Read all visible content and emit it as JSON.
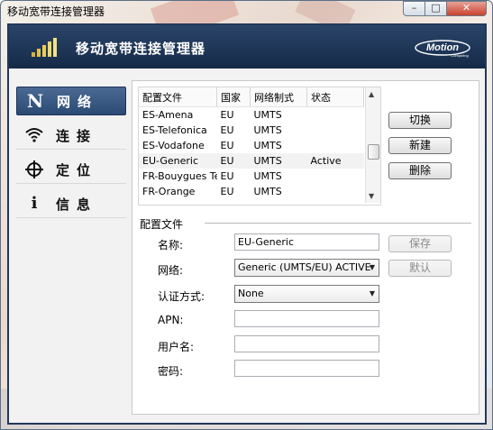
{
  "window": {
    "title": "移动宽带连接管理器",
    "minimize": "–",
    "maximize": "□",
    "close": "✕"
  },
  "header": {
    "title": "移动宽带连接管理器",
    "signal_icon": "signal-bars-icon",
    "logo_main": "Motion",
    "logo_sub": "Computing"
  },
  "nav": [
    {
      "id": "network",
      "icon_char": "N",
      "label": "网络",
      "active": true
    },
    {
      "id": "connect",
      "icon_char": "((·",
      "label": "连接",
      "active": false
    },
    {
      "id": "locate",
      "icon_char": "⊕",
      "label": "定位",
      "active": false
    },
    {
      "id": "info",
      "icon_char": "i",
      "label": "信息",
      "active": false
    }
  ],
  "profiles": {
    "columns": [
      "配置文件",
      "国家",
      "网络制式",
      "状态"
    ],
    "rows": [
      [
        "ES-Amena",
        "EU",
        "UMTS",
        ""
      ],
      [
        "ES-Telefonica",
        "EU",
        "UMTS",
        ""
      ],
      [
        "ES-Vodafone",
        "EU",
        "UMTS",
        ""
      ],
      [
        "EU-Generic",
        "EU",
        "UMTS",
        "Active"
      ],
      [
        "FR-Bouygues Tel",
        "EU",
        "UMTS",
        ""
      ],
      [
        "FR-Orange",
        "EU",
        "UMTS",
        ""
      ]
    ],
    "selected_row": 3
  },
  "actions": {
    "switch": "切换",
    "new": "新建",
    "delete": "删除"
  },
  "config": {
    "section_title": "配置文件",
    "name_label": "名称:",
    "name_value": "EU-Generic",
    "network_label": "网络:",
    "network_value": "Generic (UMTS/EU) ACTIVE",
    "auth_label": "认证方式:",
    "auth_value": "None",
    "apn_label": "APN:",
    "apn_value": "",
    "user_label": "用户名:",
    "user_value": "",
    "password_label": "密码:",
    "password_value": "",
    "save": "保存",
    "default": "默认"
  },
  "colors": {
    "header_bg": "#1c3354",
    "active_nav": "#3b5a84",
    "close_button": "#c8432f"
  }
}
